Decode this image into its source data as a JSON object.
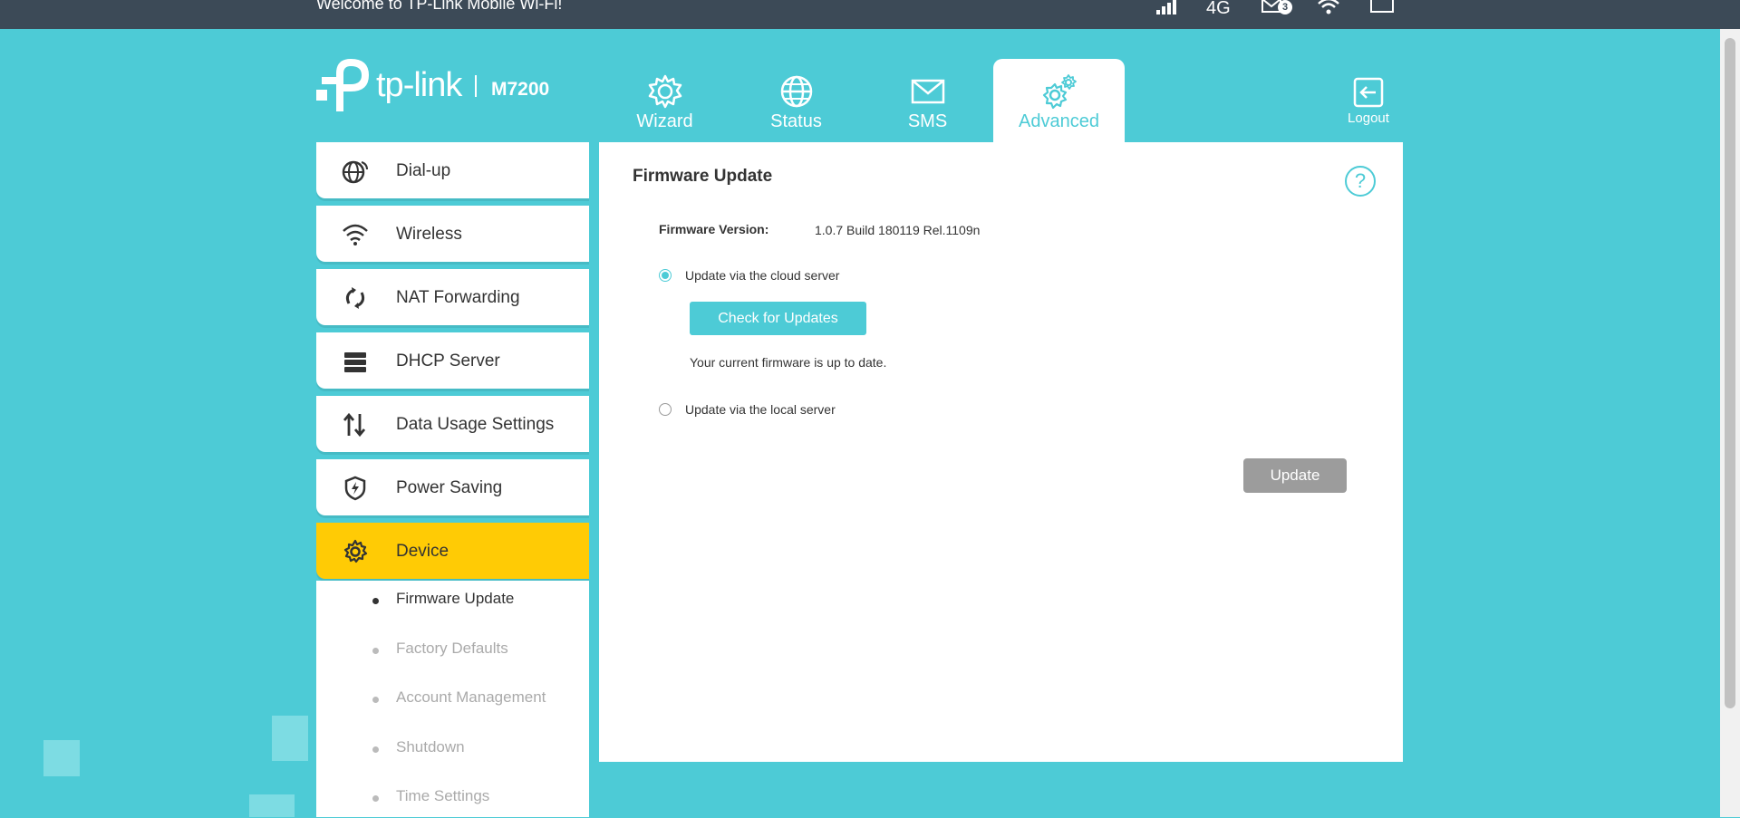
{
  "topbar": {
    "welcome": "Welcome to TP-Link Mobile Wi-Fi!",
    "network": "4G",
    "sms_count": "3",
    "icons": [
      "signal-icon",
      "mail-icon",
      "wifi-icon",
      "battery-icon"
    ]
  },
  "logo": {
    "brand": "tp-link",
    "model": "M7200"
  },
  "nav": {
    "tabs": [
      {
        "label": "Wizard",
        "icon": "gear-icon"
      },
      {
        "label": "Status",
        "icon": "globe-icon"
      },
      {
        "label": "SMS",
        "icon": "envelope-icon"
      },
      {
        "label": "Advanced",
        "icon": "gears-icon",
        "active": true
      }
    ],
    "logout": "Logout"
  },
  "sidebar": {
    "items": [
      {
        "label": "Dial-up",
        "icon": "globe-antenna-icon"
      },
      {
        "label": "Wireless",
        "icon": "wifi-icon"
      },
      {
        "label": "NAT Forwarding",
        "icon": "forwarding-icon"
      },
      {
        "label": "DHCP Server",
        "icon": "server-icon"
      },
      {
        "label": "Data Usage Settings",
        "icon": "up-down-arrows-icon"
      },
      {
        "label": "Power Saving",
        "icon": "shield-bolt-icon"
      },
      {
        "label": "Device",
        "icon": "gear-icon",
        "active": true
      }
    ],
    "sub_items": [
      {
        "label": "Firmware Update",
        "active": true
      },
      {
        "label": "Factory Defaults"
      },
      {
        "label": "Account Management"
      },
      {
        "label": "Shutdown"
      },
      {
        "label": "Time Settings"
      }
    ]
  },
  "main": {
    "title": "Firmware Update",
    "firmware_version_label": "Firmware Version:",
    "firmware_version_value": "1.0.7 Build 180119 Rel.1109n",
    "option_cloud": "Update via the cloud server",
    "check_button": "Check for Updates",
    "status_message": "Your current firmware is up to date.",
    "option_local": "Update via the local server",
    "update_button": "Update",
    "help": "?"
  },
  "colors": {
    "background": "#4dcbd6",
    "topbar": "#3c4a57",
    "accent": "#4dcbd6",
    "active_sidebar": "#ffcb05",
    "disabled_button": "#9c9c9c"
  }
}
